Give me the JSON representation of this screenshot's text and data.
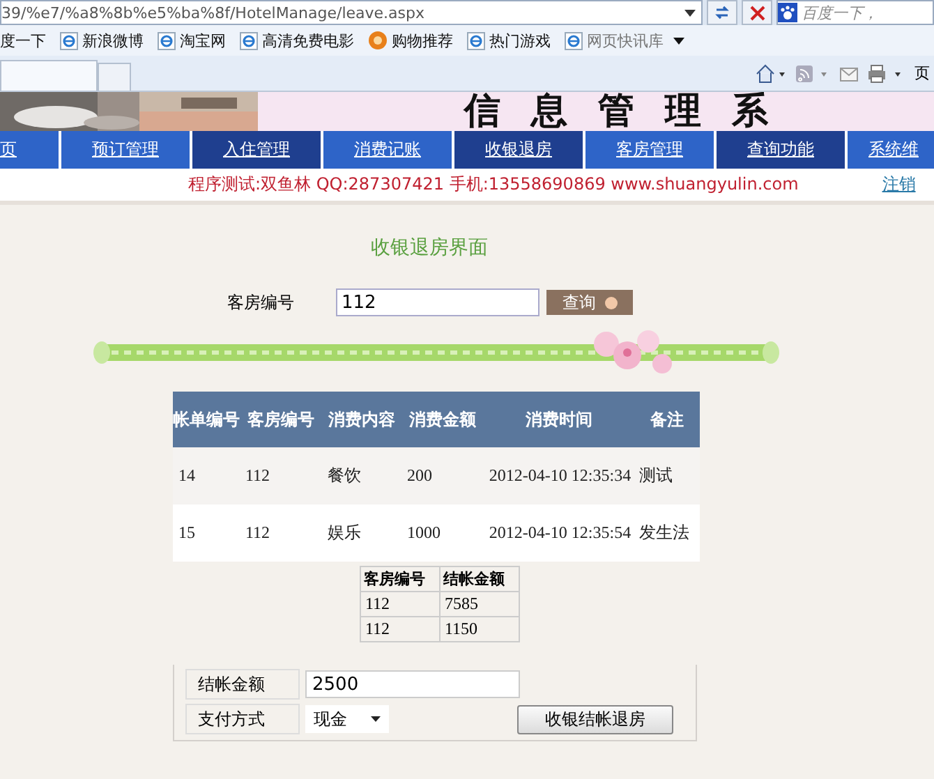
{
  "browser": {
    "address": "39/%e7/%a8%8b%e5%ba%8f/HotelManage/leave.aspx",
    "search_placeholder": "百度一下，",
    "favorites": [
      {
        "label": "度一下",
        "kind": "plain"
      },
      {
        "label": "新浪微博",
        "kind": "ie"
      },
      {
        "label": "淘宝网",
        "kind": "ie"
      },
      {
        "label": "高清免费电影",
        "kind": "ie"
      },
      {
        "label": "购物推荐",
        "kind": "shop"
      },
      {
        "label": "热门游戏",
        "kind": "ie"
      },
      {
        "label": "网页快讯库",
        "kind": "feed"
      }
    ],
    "page_menu": "页"
  },
  "banner": {
    "title": "信息管理系"
  },
  "nav": [
    {
      "label": "页",
      "selected": false
    },
    {
      "label": "预订管理",
      "selected": false
    },
    {
      "label": "入住管理",
      "selected": true
    },
    {
      "label": "消费记账",
      "selected": false
    },
    {
      "label": "收银退房",
      "selected": true
    },
    {
      "label": "客房管理",
      "selected": false
    },
    {
      "label": "查询功能",
      "selected": true
    },
    {
      "label": "系统维",
      "selected": false
    }
  ],
  "info": {
    "text": "程序测试:双鱼林 QQ:287307421 手机:13558690869 www.shuangyulin.com",
    "logout": "注销"
  },
  "heading": "收银退房界面",
  "query": {
    "label": "客房编号",
    "value": "112",
    "button": "查询"
  },
  "table": {
    "columns": [
      "帐单编号",
      "客房编号",
      "消费内容",
      "消费金额",
      "消费时间",
      "备注"
    ],
    "rows": [
      [
        "14",
        "112",
        "餐饮",
        "200",
        "2012-04-10 12:35:34",
        "测试"
      ],
      [
        "15",
        "112",
        "娱乐",
        "1000",
        "2012-04-10 12:35:54",
        "发生法"
      ]
    ]
  },
  "summary": {
    "columns": [
      "客房编号",
      "结帐金额"
    ],
    "rows": [
      [
        "112",
        "7585"
      ],
      [
        "112",
        "1150"
      ]
    ]
  },
  "checkout": {
    "amount_label": "结帐金额",
    "amount": "2500",
    "payment_label": "支付方式",
    "payment": "现金",
    "button": "收银结帐退房"
  }
}
